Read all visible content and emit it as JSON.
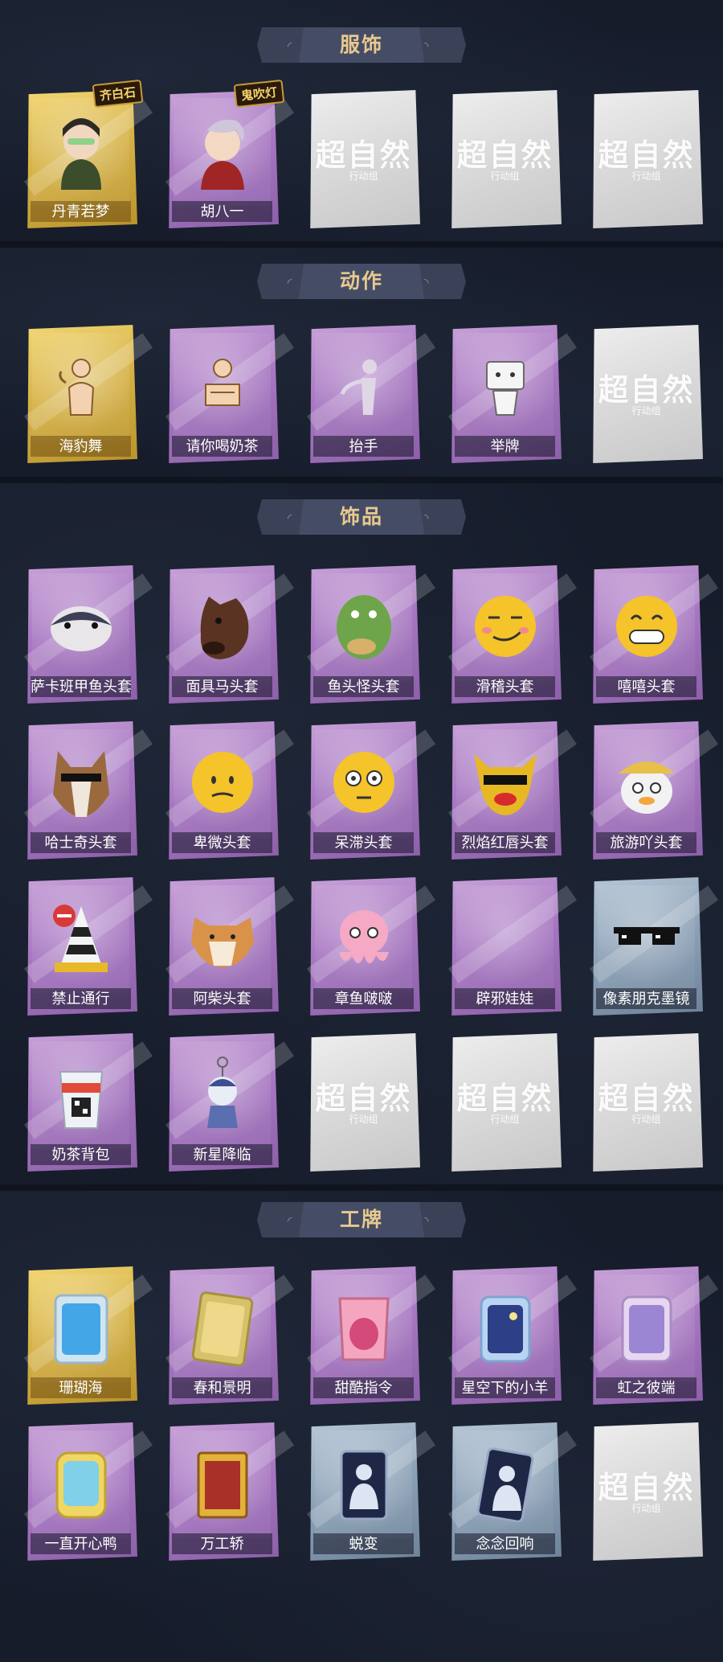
{
  "sections": [
    {
      "title": "服饰",
      "items": [
        {
          "label": "丹青若梦",
          "rarity": "gold",
          "icon": "character-costume-icon",
          "badge": "齐白石"
        },
        {
          "label": "胡八一",
          "rarity": "purple",
          "icon": "character-costume-icon",
          "badge": "鬼吹灯"
        },
        {
          "label": "",
          "rarity": "empty",
          "placeholder": "超自然",
          "placeholder_sub": "行动组"
        },
        {
          "label": "",
          "rarity": "empty",
          "placeholder": "超自然",
          "placeholder_sub": "行动组"
        },
        {
          "label": "",
          "rarity": "empty",
          "placeholder": "超自然",
          "placeholder_sub": "行动组"
        }
      ]
    },
    {
      "title": "动作",
      "items": [
        {
          "label": "海豹舞",
          "rarity": "gold",
          "icon": "dance-pose-icon"
        },
        {
          "label": "请你喝奶茶",
          "rarity": "purple",
          "icon": "sign-pose-icon"
        },
        {
          "label": "抬手",
          "rarity": "purple",
          "icon": "raise-hand-icon"
        },
        {
          "label": "举牌",
          "rarity": "purple",
          "icon": "hold-sign-icon"
        },
        {
          "label": "",
          "rarity": "empty",
          "placeholder": "超自然",
          "placeholder_sub": "行动组"
        }
      ]
    },
    {
      "title": "饰品",
      "items": [
        {
          "label": "萨卡班甲鱼头套",
          "rarity": "purple",
          "icon": "fish-head-mask-icon"
        },
        {
          "label": "面具马头套",
          "rarity": "purple",
          "icon": "horse-head-mask-icon"
        },
        {
          "label": "鱼头怪头套",
          "rarity": "purple",
          "icon": "green-fish-mask-icon"
        },
        {
          "label": "滑稽头套",
          "rarity": "purple",
          "icon": "smirk-emoji-mask-icon"
        },
        {
          "label": "嘻嘻头套",
          "rarity": "purple",
          "icon": "grin-emoji-mask-icon"
        },
        {
          "label": "哈士奇头套",
          "rarity": "purple",
          "icon": "husky-mask-icon"
        },
        {
          "label": "卑微头套",
          "rarity": "purple",
          "icon": "humble-emoji-mask-icon"
        },
        {
          "label": "呆滞头套",
          "rarity": "purple",
          "icon": "dazed-emoji-mask-icon"
        },
        {
          "label": "烈焰红唇头套",
          "rarity": "purple",
          "icon": "lips-mask-icon"
        },
        {
          "label": "旅游吖头套",
          "rarity": "purple",
          "icon": "duck-hat-mask-icon"
        },
        {
          "label": "禁止通行",
          "rarity": "purple",
          "icon": "traffic-cone-icon"
        },
        {
          "label": "阿柴头套",
          "rarity": "purple",
          "icon": "shiba-mask-icon"
        },
        {
          "label": "章鱼啵啵",
          "rarity": "purple",
          "icon": "octopus-icon"
        },
        {
          "label": "辟邪娃娃",
          "rarity": "purple",
          "icon": "blank-doll-icon"
        },
        {
          "label": "像素朋克墨镜",
          "rarity": "blue",
          "icon": "pixel-sunglasses-icon"
        },
        {
          "label": "奶茶背包",
          "rarity": "purple",
          "icon": "milk-tea-bag-icon"
        },
        {
          "label": "新星降临",
          "rarity": "purple",
          "icon": "keychain-doll-icon"
        },
        {
          "label": "",
          "rarity": "empty",
          "placeholder": "超自然",
          "placeholder_sub": "行动组"
        },
        {
          "label": "",
          "rarity": "empty",
          "placeholder": "超自然",
          "placeholder_sub": "行动组"
        },
        {
          "label": "",
          "rarity": "empty",
          "placeholder": "超自然",
          "placeholder_sub": "行动组"
        }
      ]
    },
    {
      "title": "工牌",
      "items": [
        {
          "label": "珊瑚海",
          "rarity": "gold",
          "icon": "badge-frame-icon"
        },
        {
          "label": "春和景明",
          "rarity": "purple",
          "icon": "badge-frame-icon"
        },
        {
          "label": "甜酷指令",
          "rarity": "purple",
          "icon": "badge-frame-icon"
        },
        {
          "label": "星空下的小羊",
          "rarity": "purple",
          "icon": "badge-frame-icon"
        },
        {
          "label": "虹之彼端",
          "rarity": "purple",
          "icon": "badge-frame-icon"
        },
        {
          "label": "一直开心鸭",
          "rarity": "purple",
          "icon": "badge-frame-icon"
        },
        {
          "label": "万工轿",
          "rarity": "purple",
          "icon": "badge-frame-icon"
        },
        {
          "label": "蜕变",
          "rarity": "blue",
          "icon": "silhouette-card-icon"
        },
        {
          "label": "念念回响",
          "rarity": "blue",
          "icon": "silhouette-card-icon"
        },
        {
          "label": "",
          "rarity": "empty",
          "placeholder": "超自然",
          "placeholder_sub": "行动组"
        }
      ]
    }
  ],
  "colors": {
    "background": "#161c2a",
    "banner": "#3b4258",
    "title_text": "#e8c98e",
    "gold": "#d7b347",
    "purple": "#a878c2",
    "blue": "#8ea3b8",
    "empty": "#d9d9d9"
  }
}
